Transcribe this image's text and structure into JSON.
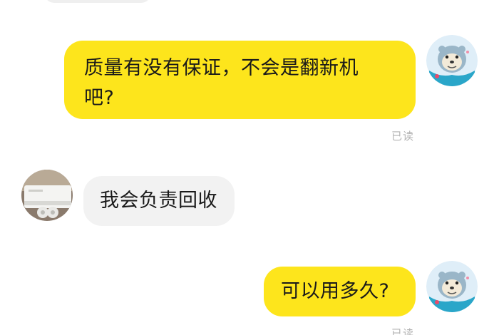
{
  "colors": {
    "my_bubble": "#fde51c",
    "their_bubble": "#f2f2f2",
    "read_status": "#b3b3b3"
  },
  "messages": [
    {
      "sender": "me",
      "text_line1": "质量有没有保证，不会是翻新机",
      "text_line2": "吧?",
      "status": "已读",
      "avatar": "seal-avatar-icon"
    },
    {
      "sender": "other",
      "text": "我会负责回收",
      "avatar": "air-conditioner-photo-avatar"
    },
    {
      "sender": "me",
      "text": "可以用多久?",
      "status": "已读",
      "avatar": "seal-avatar-icon"
    }
  ]
}
